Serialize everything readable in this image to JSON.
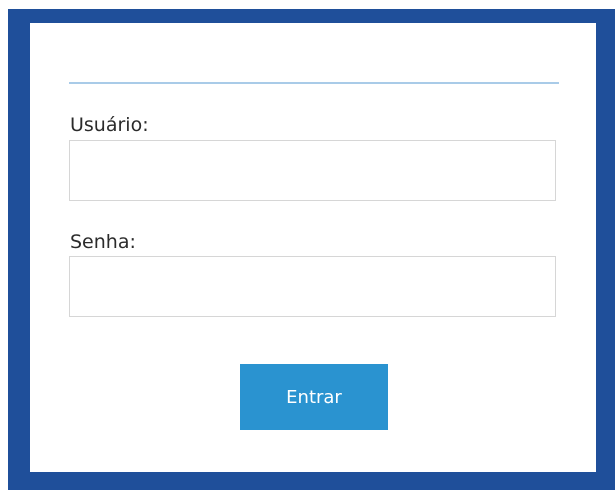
{
  "form": {
    "username_label": "Usuário:",
    "username_value": "",
    "password_label": "Senha:",
    "password_value": "",
    "submit_label": "Entrar"
  },
  "colors": {
    "frame": "#1f4f9a",
    "panel": "#ffffff",
    "divider": "#a9cbe8",
    "button": "#2a93d0",
    "button_text": "#ffffff"
  }
}
